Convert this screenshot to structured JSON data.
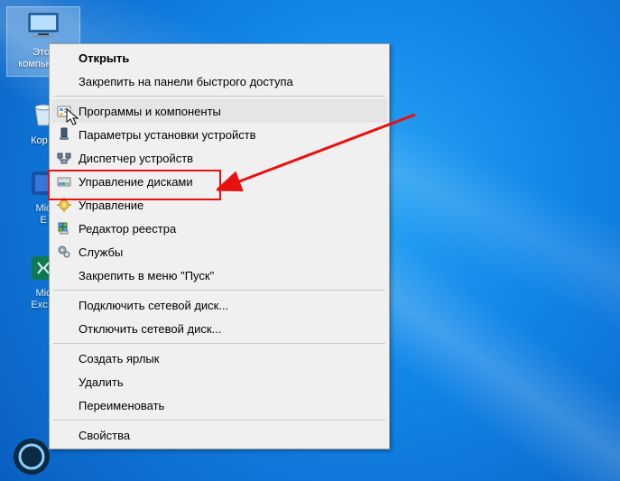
{
  "desktop": {
    "selected_icon": {
      "label": "Этот компьютер",
      "kind": "this-pc"
    },
    "icons": [
      {
        "label": "Кор...",
        "kind": "recycle-bin"
      },
      {
        "label": "",
        "kind": "partial-app-a"
      },
      {
        "label": "Mic\nE",
        "kind": "partial-edge"
      },
      {
        "label": "",
        "kind": "partial-app-b"
      },
      {
        "label": "Mic\nExc...",
        "kind": "partial-excel"
      }
    ]
  },
  "menu": {
    "groups": [
      [
        {
          "id": "open",
          "label": "Открыть",
          "bold": true,
          "icon": ""
        },
        {
          "id": "pin-quick",
          "label": "Закрепить на панели быстрого доступа",
          "bold": false,
          "icon": ""
        }
      ],
      [
        {
          "id": "programs",
          "label": "Программы и компоненты",
          "bold": false,
          "icon": "programs-icon",
          "hover": true,
          "cursor": true
        },
        {
          "id": "dev-settings",
          "label": "Параметры установки устройств",
          "bold": false,
          "icon": "device-settings-icon"
        },
        {
          "id": "dev-manager",
          "label": "Диспетчер устройств",
          "bold": false,
          "icon": "device-manager-icon"
        },
        {
          "id": "disk-mgmt",
          "label": "Управление дисками",
          "bold": false,
          "icon": "disk-mgmt-icon",
          "highlight": true
        },
        {
          "id": "manage",
          "label": "Управление",
          "bold": false,
          "icon": "manage-icon"
        },
        {
          "id": "regedit",
          "label": "Редактор реестра",
          "bold": false,
          "icon": "regedit-icon"
        },
        {
          "id": "services",
          "label": "Службы",
          "bold": false,
          "icon": "services-icon"
        },
        {
          "id": "pin-start",
          "label": "Закрепить в меню \"Пуск\"",
          "bold": false,
          "icon": ""
        }
      ],
      [
        {
          "id": "map-drive",
          "label": "Подключить сетевой диск...",
          "bold": false,
          "icon": ""
        },
        {
          "id": "unmap-drive",
          "label": "Отключить сетевой диск...",
          "bold": false,
          "icon": ""
        }
      ],
      [
        {
          "id": "shortcut",
          "label": "Создать ярлык",
          "bold": false,
          "icon": ""
        },
        {
          "id": "delete",
          "label": "Удалить",
          "bold": false,
          "icon": ""
        },
        {
          "id": "rename",
          "label": "Переименовать",
          "bold": false,
          "icon": ""
        }
      ],
      [
        {
          "id": "properties",
          "label": "Свойства",
          "bold": false,
          "icon": ""
        }
      ]
    ]
  },
  "annotation": {
    "color": "#e8110f"
  }
}
